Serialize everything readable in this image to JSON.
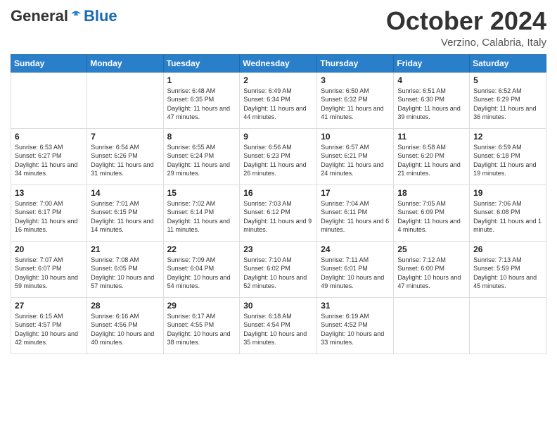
{
  "header": {
    "logo_general": "General",
    "logo_blue": "Blue",
    "month_title": "October 2024",
    "location": "Verzino, Calabria, Italy"
  },
  "calendar": {
    "days_of_week": [
      "Sunday",
      "Monday",
      "Tuesday",
      "Wednesday",
      "Thursday",
      "Friday",
      "Saturday"
    ],
    "weeks": [
      [
        {
          "day": "",
          "sunrise": "",
          "sunset": "",
          "daylight": ""
        },
        {
          "day": "",
          "sunrise": "",
          "sunset": "",
          "daylight": ""
        },
        {
          "day": "1",
          "sunrise": "Sunrise: 6:48 AM",
          "sunset": "Sunset: 6:35 PM",
          "daylight": "Daylight: 11 hours and 47 minutes."
        },
        {
          "day": "2",
          "sunrise": "Sunrise: 6:49 AM",
          "sunset": "Sunset: 6:34 PM",
          "daylight": "Daylight: 11 hours and 44 minutes."
        },
        {
          "day": "3",
          "sunrise": "Sunrise: 6:50 AM",
          "sunset": "Sunset: 6:32 PM",
          "daylight": "Daylight: 11 hours and 41 minutes."
        },
        {
          "day": "4",
          "sunrise": "Sunrise: 6:51 AM",
          "sunset": "Sunset: 6:30 PM",
          "daylight": "Daylight: 11 hours and 39 minutes."
        },
        {
          "day": "5",
          "sunrise": "Sunrise: 6:52 AM",
          "sunset": "Sunset: 6:29 PM",
          "daylight": "Daylight: 11 hours and 36 minutes."
        }
      ],
      [
        {
          "day": "6",
          "sunrise": "Sunrise: 6:53 AM",
          "sunset": "Sunset: 6:27 PM",
          "daylight": "Daylight: 11 hours and 34 minutes."
        },
        {
          "day": "7",
          "sunrise": "Sunrise: 6:54 AM",
          "sunset": "Sunset: 6:26 PM",
          "daylight": "Daylight: 11 hours and 31 minutes."
        },
        {
          "day": "8",
          "sunrise": "Sunrise: 6:55 AM",
          "sunset": "Sunset: 6:24 PM",
          "daylight": "Daylight: 11 hours and 29 minutes."
        },
        {
          "day": "9",
          "sunrise": "Sunrise: 6:56 AM",
          "sunset": "Sunset: 6:23 PM",
          "daylight": "Daylight: 11 hours and 26 minutes."
        },
        {
          "day": "10",
          "sunrise": "Sunrise: 6:57 AM",
          "sunset": "Sunset: 6:21 PM",
          "daylight": "Daylight: 11 hours and 24 minutes."
        },
        {
          "day": "11",
          "sunrise": "Sunrise: 6:58 AM",
          "sunset": "Sunset: 6:20 PM",
          "daylight": "Daylight: 11 hours and 21 minutes."
        },
        {
          "day": "12",
          "sunrise": "Sunrise: 6:59 AM",
          "sunset": "Sunset: 6:18 PM",
          "daylight": "Daylight: 11 hours and 19 minutes."
        }
      ],
      [
        {
          "day": "13",
          "sunrise": "Sunrise: 7:00 AM",
          "sunset": "Sunset: 6:17 PM",
          "daylight": "Daylight: 11 hours and 16 minutes."
        },
        {
          "day": "14",
          "sunrise": "Sunrise: 7:01 AM",
          "sunset": "Sunset: 6:15 PM",
          "daylight": "Daylight: 11 hours and 14 minutes."
        },
        {
          "day": "15",
          "sunrise": "Sunrise: 7:02 AM",
          "sunset": "Sunset: 6:14 PM",
          "daylight": "Daylight: 11 hours and 11 minutes."
        },
        {
          "day": "16",
          "sunrise": "Sunrise: 7:03 AM",
          "sunset": "Sunset: 6:12 PM",
          "daylight": "Daylight: 11 hours and 9 minutes."
        },
        {
          "day": "17",
          "sunrise": "Sunrise: 7:04 AM",
          "sunset": "Sunset: 6:11 PM",
          "daylight": "Daylight: 11 hours and 6 minutes."
        },
        {
          "day": "18",
          "sunrise": "Sunrise: 7:05 AM",
          "sunset": "Sunset: 6:09 PM",
          "daylight": "Daylight: 11 hours and 4 minutes."
        },
        {
          "day": "19",
          "sunrise": "Sunrise: 7:06 AM",
          "sunset": "Sunset: 6:08 PM",
          "daylight": "Daylight: 11 hours and 1 minute."
        }
      ],
      [
        {
          "day": "20",
          "sunrise": "Sunrise: 7:07 AM",
          "sunset": "Sunset: 6:07 PM",
          "daylight": "Daylight: 10 hours and 59 minutes."
        },
        {
          "day": "21",
          "sunrise": "Sunrise: 7:08 AM",
          "sunset": "Sunset: 6:05 PM",
          "daylight": "Daylight: 10 hours and 57 minutes."
        },
        {
          "day": "22",
          "sunrise": "Sunrise: 7:09 AM",
          "sunset": "Sunset: 6:04 PM",
          "daylight": "Daylight: 10 hours and 54 minutes."
        },
        {
          "day": "23",
          "sunrise": "Sunrise: 7:10 AM",
          "sunset": "Sunset: 6:02 PM",
          "daylight": "Daylight: 10 hours and 52 minutes."
        },
        {
          "day": "24",
          "sunrise": "Sunrise: 7:11 AM",
          "sunset": "Sunset: 6:01 PM",
          "daylight": "Daylight: 10 hours and 49 minutes."
        },
        {
          "day": "25",
          "sunrise": "Sunrise: 7:12 AM",
          "sunset": "Sunset: 6:00 PM",
          "daylight": "Daylight: 10 hours and 47 minutes."
        },
        {
          "day": "26",
          "sunrise": "Sunrise: 7:13 AM",
          "sunset": "Sunset: 5:59 PM",
          "daylight": "Daylight: 10 hours and 45 minutes."
        }
      ],
      [
        {
          "day": "27",
          "sunrise": "Sunrise: 6:15 AM",
          "sunset": "Sunset: 4:57 PM",
          "daylight": "Daylight: 10 hours and 42 minutes."
        },
        {
          "day": "28",
          "sunrise": "Sunrise: 6:16 AM",
          "sunset": "Sunset: 4:56 PM",
          "daylight": "Daylight: 10 hours and 40 minutes."
        },
        {
          "day": "29",
          "sunrise": "Sunrise: 6:17 AM",
          "sunset": "Sunset: 4:55 PM",
          "daylight": "Daylight: 10 hours and 38 minutes."
        },
        {
          "day": "30",
          "sunrise": "Sunrise: 6:18 AM",
          "sunset": "Sunset: 4:54 PM",
          "daylight": "Daylight: 10 hours and 35 minutes."
        },
        {
          "day": "31",
          "sunrise": "Sunrise: 6:19 AM",
          "sunset": "Sunset: 4:52 PM",
          "daylight": "Daylight: 10 hours and 33 minutes."
        },
        {
          "day": "",
          "sunrise": "",
          "sunset": "",
          "daylight": ""
        },
        {
          "day": "",
          "sunrise": "",
          "sunset": "",
          "daylight": ""
        }
      ]
    ]
  }
}
